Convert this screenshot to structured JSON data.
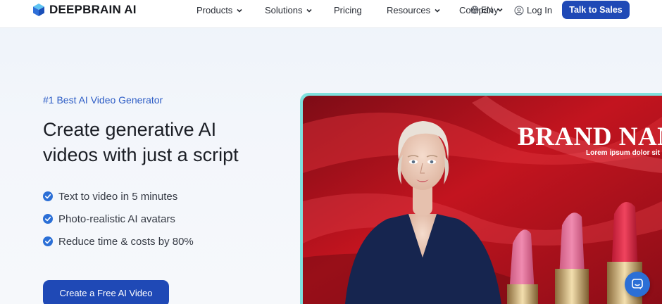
{
  "brand": {
    "logo_text": "DEEPBRAIN AI"
  },
  "nav": {
    "products": "Products",
    "solutions": "Solutions",
    "pricing": "Pricing",
    "resources": "Resources",
    "company": "Company",
    "language": "EN",
    "login": "Log In",
    "talk_to_sales": "Talk to Sales"
  },
  "hero": {
    "eyebrow": "#1 Best AI Video Generator",
    "headline_line1": "Create generative AI",
    "headline_line2": "videos with just a script",
    "features": [
      "Text to video in 5 minutes",
      "Photo-realistic AI avatars",
      "Reduce time & costs by 80%"
    ],
    "cta": "Create a Free AI Video"
  },
  "video": {
    "brand_title": "BRAND NAM",
    "brand_subtitle": "Lorem ipsum dolor sit"
  },
  "colors": {
    "primary": "#1f49b6",
    "eyebrow": "#2c5cc5",
    "check": "#2b6fd6",
    "video_bg": "#b1121e"
  },
  "icons": {
    "logo": "cube-logo-icon",
    "language": "globe-icon",
    "login": "user-icon",
    "feature": "check-circle-icon",
    "chat": "chat-icon"
  }
}
